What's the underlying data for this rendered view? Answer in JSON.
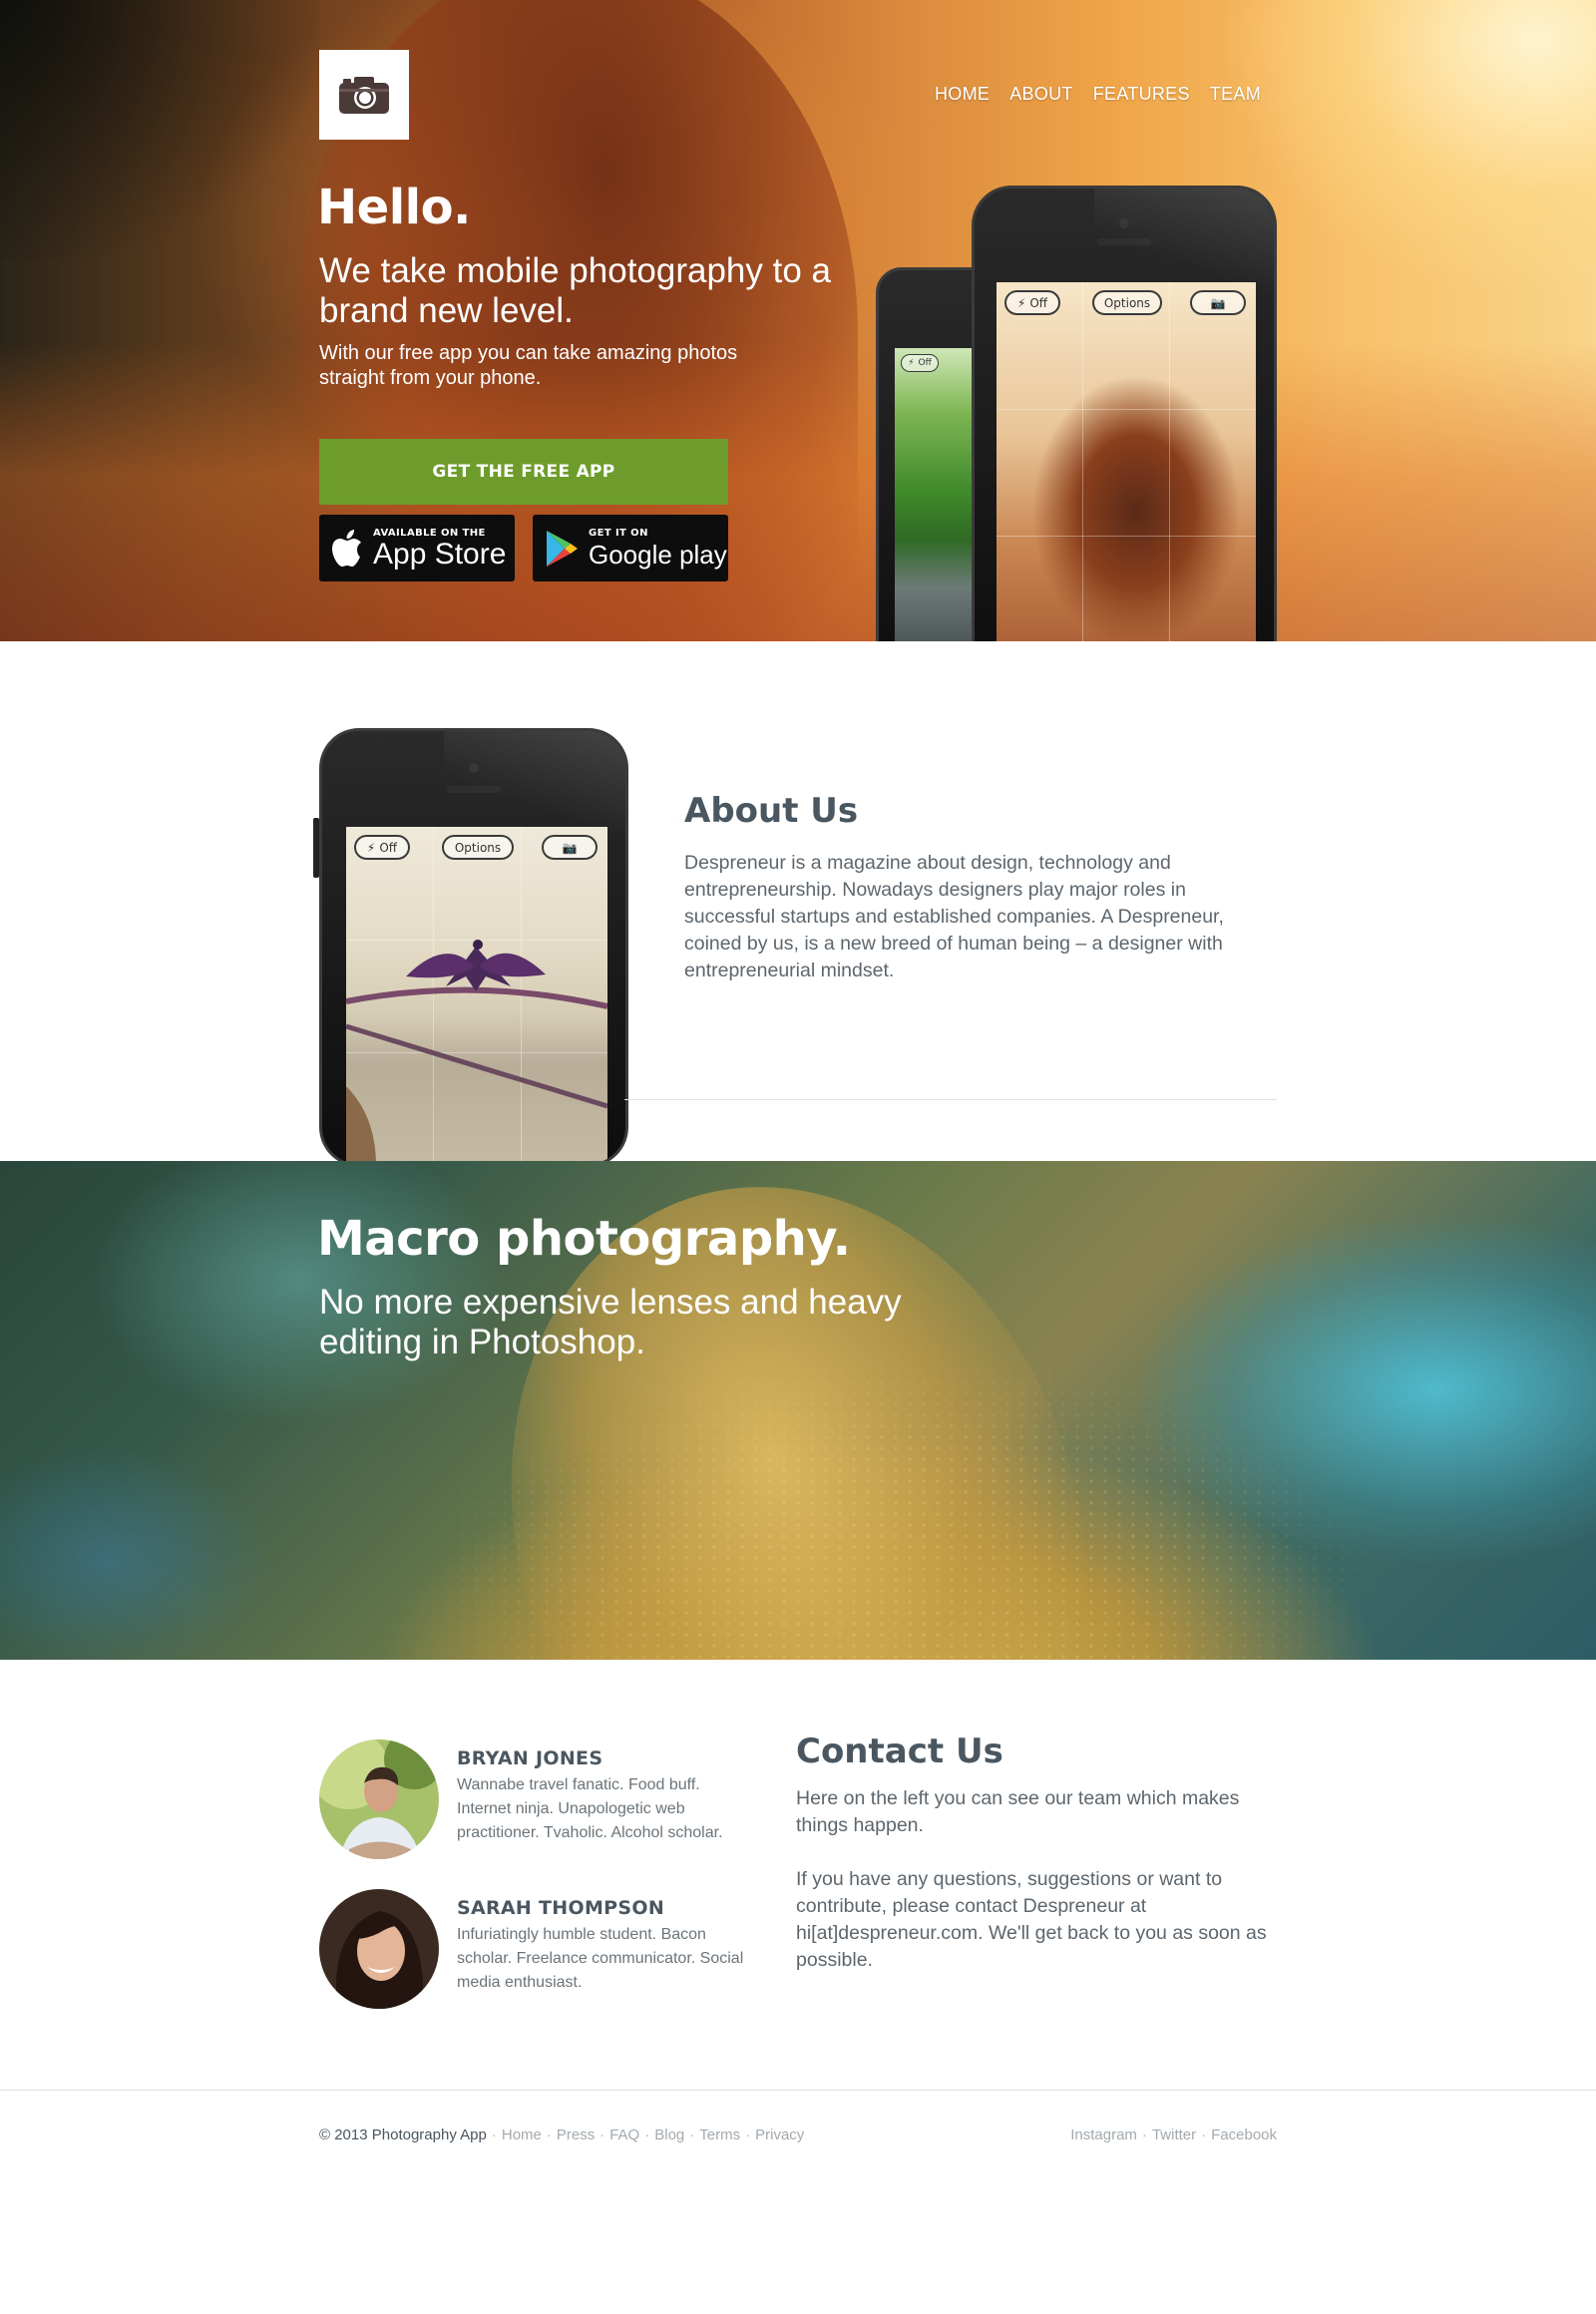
{
  "nav": {
    "items": [
      "HOME",
      "ABOUT",
      "FEATURES",
      "TEAM"
    ]
  },
  "hero": {
    "title": "Hello.",
    "tagline": "We take mobile photography to a brand new level.",
    "subtitle": "With our free app you can take amazing photos straight from your phone.",
    "cta_label": "GET THE FREE APP",
    "app_store": {
      "small": "AVAILABLE ON THE",
      "big": "App Store"
    },
    "google_play": {
      "small": "GET IT ON",
      "big": "Google play"
    }
  },
  "camera_ui": {
    "flash_label": "Off",
    "options_label": "Options"
  },
  "about": {
    "title": "About Us",
    "text": "Despreneur is a magazine about design, technology and entrepreneurship. Nowadays designers play major roles in successful startups and established companies. A Despreneur, coined by us, is  a new breed of human being – a designer with entrepreneurial mindset."
  },
  "macro": {
    "title": "Macro photography.",
    "tagline": "No more expensive lenses and heavy editing in Photoshop."
  },
  "team": [
    {
      "name": "BRYAN JONES",
      "bio": "Wannabe travel fanatic. Food buff. Internet ninja. Unapologetic web practitioner. Tvaholic. Alcohol scholar."
    },
    {
      "name": "SARAH THOMPSON",
      "bio": "Infuriatingly humble student. Bacon scholar. Freelance communicator. Social media enthusiast."
    }
  ],
  "contact": {
    "title": "Contact Us",
    "p1": "Here on the left you can see our team which makes things happen.",
    "p2": "If you have any questions, suggestions or want to contribute, please contact Despreneur at hi[at]despreneur.com. We'll get back to you as soon as possible."
  },
  "footer": {
    "copyright": "© 2013 Photography App",
    "links": [
      "Home",
      "Press",
      "FAQ",
      "Blog",
      "Terms",
      "Privacy"
    ],
    "social": [
      "Instagram",
      "Twitter",
      "Facebook"
    ]
  },
  "colors": {
    "accent_green": "#6e9c2c",
    "heading": "#4a5760",
    "body_text": "#5d666d",
    "footer_link": "#a3aaaf"
  }
}
